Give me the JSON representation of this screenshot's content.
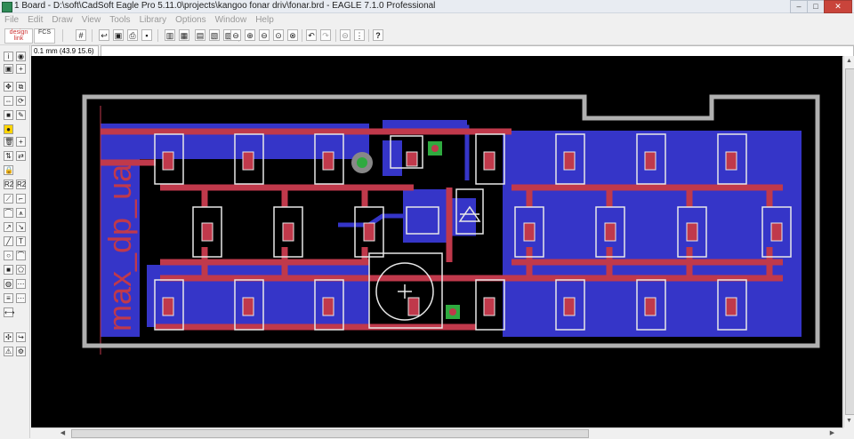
{
  "window": {
    "title": "1 Board - D:\\soft\\CadSoft Eagle Pro 5.11.0\\projects\\kangoo fonar driv\\fonar.brd - EAGLE 7.1.0 Professional",
    "minimize_glyph": "–",
    "maximize_glyph": "□",
    "close_glyph": "✕"
  },
  "menu": {
    "items": [
      "File",
      "Edit",
      "Draw",
      "View",
      "Tools",
      "Library",
      "Options",
      "Window",
      "Help"
    ]
  },
  "toolbar": {
    "logo_text": "design link",
    "logo2_text": "FCS",
    "icons": [
      "grid-icon",
      "open-icon",
      "save-icon",
      "print-icon",
      "cam-icon",
      "layers-icon",
      "schematic-icon",
      "board-icon",
      "ulp-icon",
      "script-icon",
      "zoom-fit-icon",
      "zoom-in-icon",
      "zoom-out-icon",
      "zoom-redraw-icon",
      "zoom-select-icon",
      "undo-icon",
      "redo-icon",
      "stop-icon",
      "go-icon",
      "help-icon"
    ]
  },
  "coord": {
    "readout": "0.1 mm (43.9 15.6)"
  },
  "board": {
    "silk_text": "max_dp_ua"
  },
  "colors": {
    "background": "#000000",
    "top_copper": "#c0394b",
    "bottom_copper": "#3535c8",
    "dimension": "#b0b0b0",
    "pad": "#e8e8e8",
    "via_green": "#2faa3f"
  }
}
